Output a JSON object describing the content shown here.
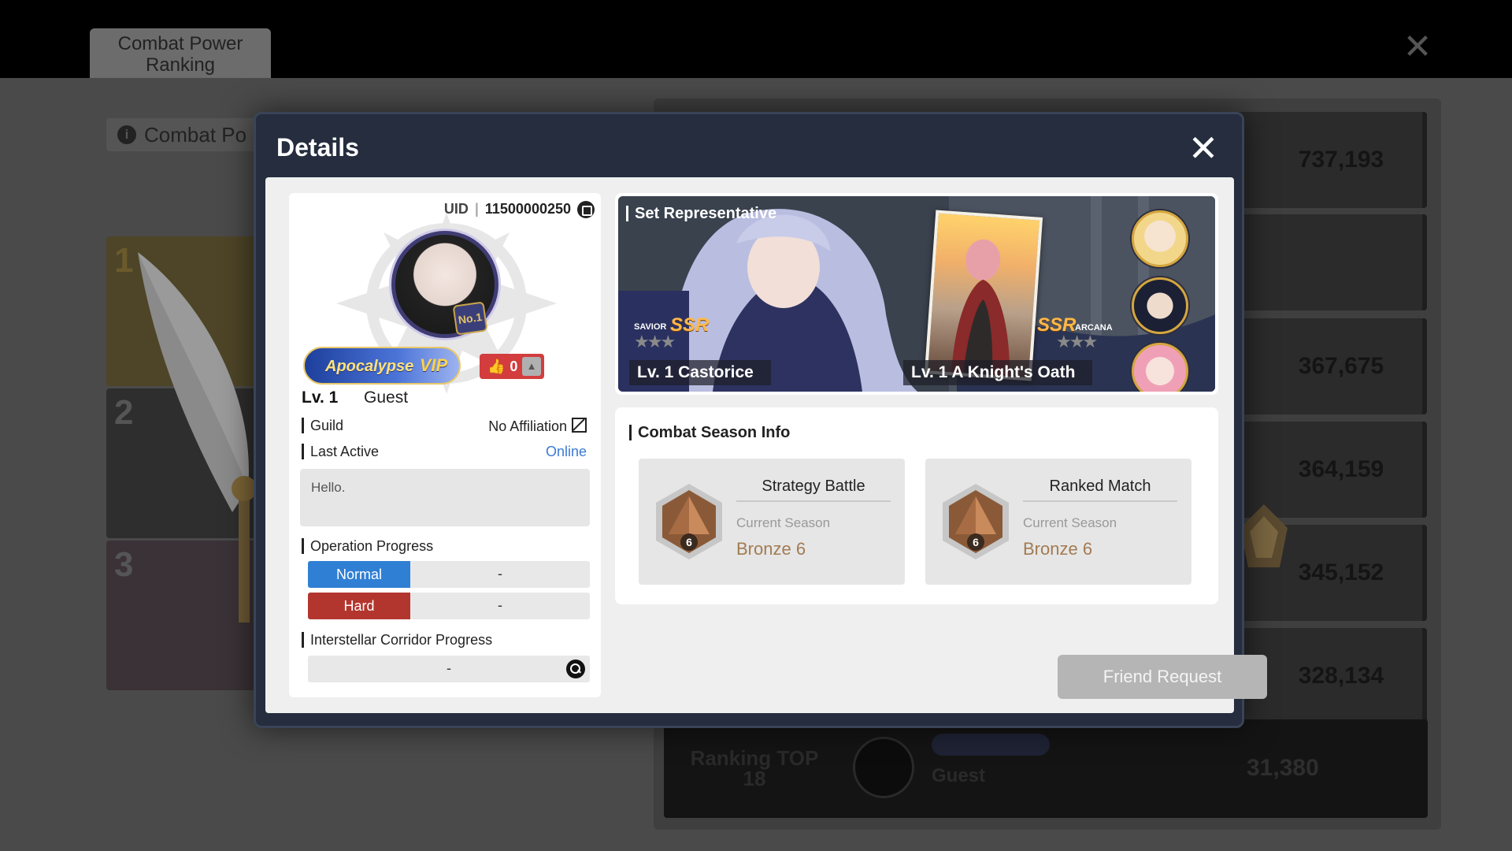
{
  "background": {
    "tab_label": "Combat Power Ranking",
    "info_label": "Combat Po",
    "podium": [
      "1",
      "2",
      "3"
    ],
    "rank_scores": [
      "737,193",
      "",
      "367,675",
      "364,159",
      "345,152",
      "328,134"
    ],
    "self_rank_label": "Ranking TOP 18",
    "self_name": "Guest",
    "self_score": "31,380"
  },
  "modal": {
    "title": "Details",
    "profile": {
      "uid_label": "UID",
      "uid_value": "11500000250",
      "avatar_badge": "No.1",
      "vip_text": "Apocalypse",
      "vip_suffix": "VIP",
      "likes": "0",
      "level": "Lv. 1",
      "name": "Guest",
      "guild_label": "Guild",
      "guild_value": "No Affiliation",
      "active_label": "Last Active",
      "active_value": "Online",
      "intro": "Hello.",
      "operation_label": "Operation Progress",
      "normal_label": "Normal",
      "normal_value": "-",
      "hard_label": "Hard",
      "hard_value": "-",
      "interstellar_label": "Interstellar Corridor Progress",
      "interstellar_value": "-"
    },
    "representatives": {
      "title": "Set Representative",
      "main_sub": "SAVIOR",
      "main_rarity": "SSR",
      "main_stars": "★★★",
      "main_label": "Lv. 1 Castorice",
      "card_sub": "ARCANA",
      "card_rarity": "SSR",
      "card_stars": "★★★",
      "card_label": "Lv. 1 A Knight's Oath"
    },
    "season": {
      "title": "Combat Season Info",
      "cards": [
        {
          "mode": "Strategy Battle",
          "current_label": "Current Season",
          "tier": "Bronze 6",
          "badge": "6"
        },
        {
          "mode": "Ranked Match",
          "current_label": "Current Season",
          "tier": "Bronze 6",
          "badge": "6"
        }
      ]
    },
    "friend_button": "Friend Request"
  },
  "colors": {
    "normal": "#2f7fd4",
    "hard": "#b3362e",
    "like": "#d33d3d",
    "online": "#3a7bd5",
    "tier": "#a27b52"
  }
}
